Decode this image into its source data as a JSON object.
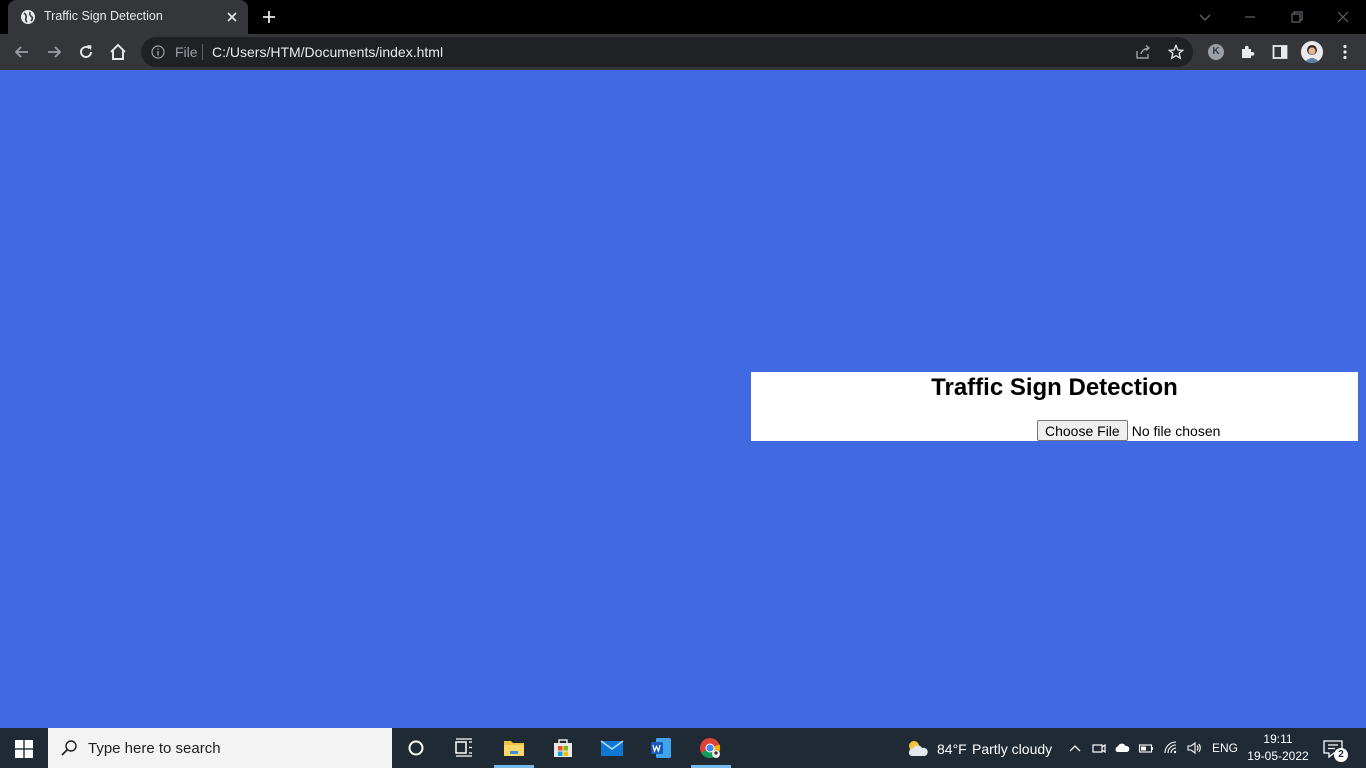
{
  "browser": {
    "tab_title": "Traffic Sign Detection",
    "omnibox": {
      "scheme_label": "File",
      "url": "C:/Users/HTM/Documents/index.html"
    },
    "profile_initial": "K"
  },
  "page": {
    "background_color": "#4169e1",
    "heading": "Traffic Sign Detection",
    "file_input": {
      "button_label": "Choose File",
      "status": "No file chosen"
    }
  },
  "taskbar": {
    "search_placeholder": "Type here to search",
    "weather": {
      "temperature": "84°F",
      "condition": "Partly cloudy"
    },
    "language": "ENG",
    "time": "19:11",
    "date": "19-05-2022",
    "notification_count": "2"
  }
}
